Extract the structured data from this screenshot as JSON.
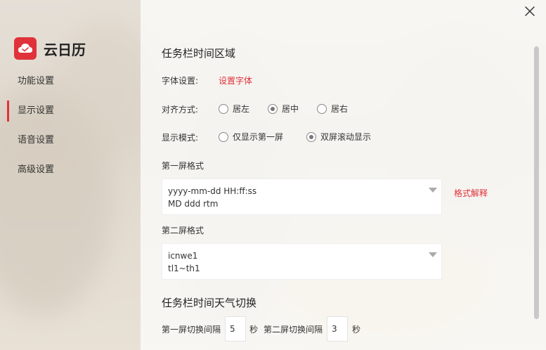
{
  "app": {
    "name": "云日历",
    "brand_color": "#e0323a"
  },
  "sidebar": {
    "items": [
      {
        "label": "功能设置",
        "active": false
      },
      {
        "label": "显示设置",
        "active": true
      },
      {
        "label": "语音设置",
        "active": false
      },
      {
        "label": "高级设置",
        "active": false
      }
    ]
  },
  "section1": {
    "title": "任务栏时间区域",
    "font_label": "字体设置:",
    "font_link": "设置字体",
    "align_label": "对齐方式:",
    "align_options": [
      {
        "label": "居左",
        "selected": false
      },
      {
        "label": "居中",
        "selected": true
      },
      {
        "label": "居右",
        "selected": false
      }
    ],
    "mode_label": "显示模式:",
    "mode_options": [
      {
        "label": "仅显示第一屏",
        "selected": false
      },
      {
        "label": "双屏滚动显示",
        "selected": true
      }
    ],
    "screen1_label": "第一屏格式",
    "screen1_lines": [
      "yyyy-mm-dd HH:ff:ss",
      "MD ddd rtm"
    ],
    "format_help_link": "格式解释",
    "screen2_label": "第二屏格式",
    "screen2_lines": [
      "icnwe1",
      "tl1~th1"
    ]
  },
  "section2": {
    "title": "任务栏时间天气切换",
    "screen1_interval_label": "第一屏切换间隔",
    "screen1_interval_value": "5",
    "unit1": "秒",
    "screen2_interval_label": "第二屏切换间隔",
    "screen2_interval_value": "3",
    "unit2": "秒"
  }
}
